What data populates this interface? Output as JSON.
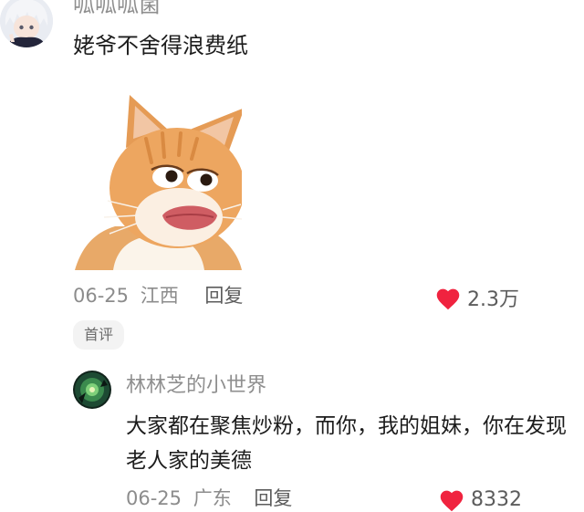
{
  "comments": [
    {
      "username": "呱呱呱菌",
      "text": "姥爷不舍得浪费纸",
      "date": "06-25",
      "location": "江西",
      "reply_label": "回复",
      "likes": "2.3万",
      "badge": "首评"
    }
  ],
  "replies": [
    {
      "username": "林林芝的小世界",
      "text": "大家都在聚焦炒粉，而你，我的姐妹，你在发现老人家的美德",
      "date": "06-25",
      "location": "广东",
      "reply_label": "回复",
      "likes": "8332"
    }
  ],
  "icons": {
    "like": "heart-icon"
  },
  "colors": {
    "heart": "#f0233f",
    "meta_text": "#8c8c8c",
    "badge_bg": "#f3f3f3"
  }
}
